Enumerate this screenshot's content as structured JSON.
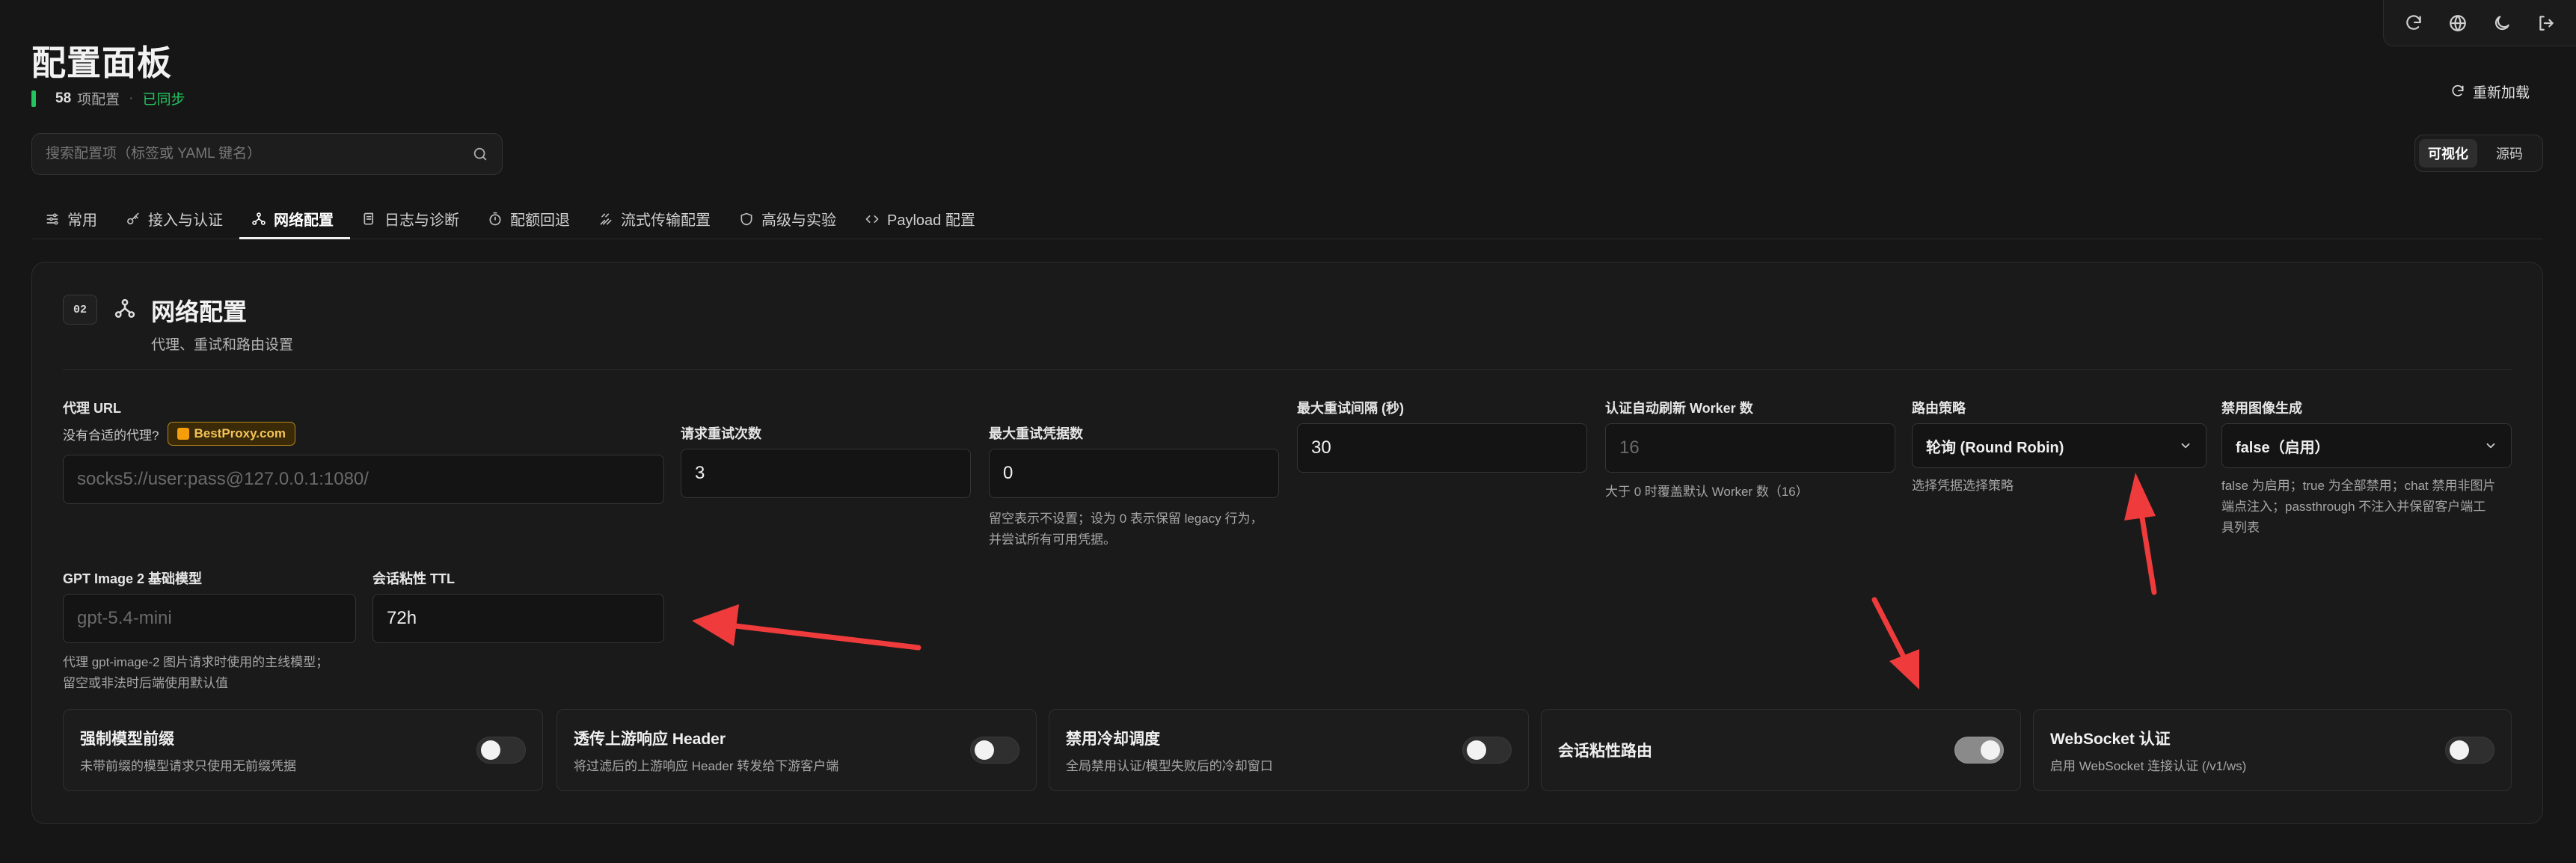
{
  "header": {
    "title": "配置面板",
    "count": "58",
    "count_suffix": "项配置",
    "separator": "·",
    "sync_status": "已同步",
    "reload_label": "重新加载"
  },
  "search": {
    "placeholder": "搜索配置项（标签或 YAML 键名）",
    "value": ""
  },
  "view_toggle": {
    "visual": "可视化",
    "source": "源码",
    "active": "visual"
  },
  "tabs": [
    {
      "label": "常用",
      "icon": "sliders-icon"
    },
    {
      "label": "接入与认证",
      "icon": "key-icon"
    },
    {
      "label": "网络配置",
      "icon": "network-icon",
      "active": true
    },
    {
      "label": "日志与诊断",
      "icon": "scroll-icon"
    },
    {
      "label": "配额回退",
      "icon": "timer-icon"
    },
    {
      "label": "流式传输配置",
      "icon": "stream-icon"
    },
    {
      "label": "高级与实验",
      "icon": "shield-icon"
    },
    {
      "label": "Payload 配置",
      "icon": "code-icon"
    }
  ],
  "section": {
    "badge": "02",
    "title": "网络配置",
    "subtitle": "代理、重试和路由设置"
  },
  "fields": {
    "proxy_url": {
      "label": "代理 URL",
      "ask": "没有合适的代理?",
      "chip": "BestProxy.com",
      "placeholder": "socks5://user:pass@127.0.0.1:1080/",
      "value": ""
    },
    "retry_count": {
      "label": "请求重试次数",
      "value": "3"
    },
    "max_retry_credentials": {
      "label": "最大重试凭据数",
      "value": "0",
      "help1": "留空表示不设置；设为 0 表示保留 legacy 行为，",
      "help2": "并尝试所有可用凭据。"
    },
    "max_retry_interval": {
      "label": "最大重试间隔 (秒)",
      "value": "30"
    },
    "auth_refresh_workers": {
      "label": "认证自动刷新 Worker 数",
      "placeholder": "16",
      "value": "",
      "help": "大于 0 时覆盖默认 Worker 数（16）"
    },
    "routing_strategy": {
      "label": "路由策略",
      "value": "轮询 (Round Robin)",
      "help": "选择凭据选择策略"
    },
    "disable_image_gen": {
      "label": "禁用图像生成",
      "value": "false（启用）",
      "help1": "false 为启用；true 为全部禁用；chat 禁用非图片",
      "help2": "端点注入；passthrough 不注入并保留客户端工",
      "help3": "具列表"
    },
    "gpt_image_model": {
      "label": "GPT Image 2 基础模型",
      "placeholder": "gpt-5.4-mini",
      "value": "",
      "help1": "代理 gpt-image-2 图片请求时使用的主线模型；",
      "help2": "留空或非法时后端使用默认值"
    },
    "session_ttl": {
      "label": "会话粘性 TTL",
      "value": "72h"
    }
  },
  "toggles": [
    {
      "title": "强制模型前缀",
      "desc": "未带前缀的模型请求只使用无前缀凭据",
      "on": false
    },
    {
      "title": "透传上游响应 Header",
      "desc": "将过滤后的上游响应 Header 转发给下游客户端",
      "on": false
    },
    {
      "title": "禁用冷却调度",
      "desc": "全局禁用认证/模型失败后的冷却窗口",
      "on": false
    },
    {
      "title": "会话粘性路由",
      "desc": "",
      "on": true
    },
    {
      "title": "WebSocket 认证",
      "desc": "启用 WebSocket 连接认证 (/v1/ws)",
      "on": false
    }
  ],
  "colors": {
    "background": "#161616",
    "panel": "#1a1a1a",
    "accent_green": "#22c55e",
    "chip_gold": "#f4c358",
    "annotation_red": "#ef3b3b"
  },
  "topbar_icons": [
    "refresh-icon",
    "globe-icon",
    "moon-icon",
    "logout-icon"
  ]
}
